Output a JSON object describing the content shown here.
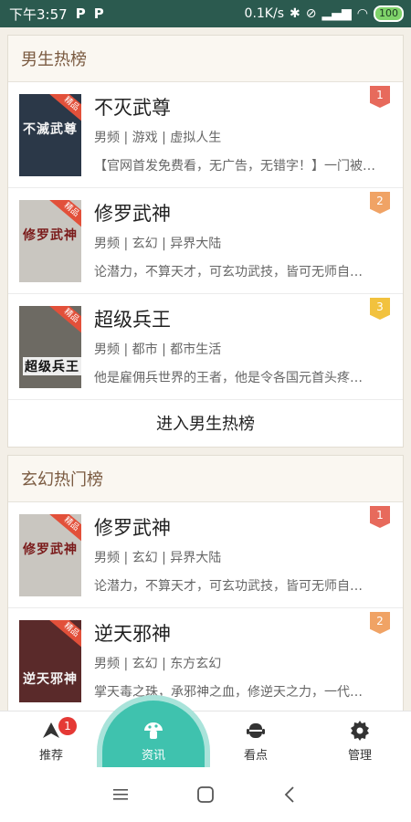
{
  "status": {
    "time": "下午3:57",
    "app_icons": [
      "P",
      "P"
    ],
    "speed": "0.1K/s",
    "battery": "100"
  },
  "sections": [
    {
      "title": "男生热榜",
      "more_label": "进入男生热榜",
      "books": [
        {
          "title": "不灭武尊",
          "tags": "男频  |  游戏  |  虚拟人生",
          "desc": "【官网首发免费看，无广告，无错字！】一门被…",
          "rank": "1",
          "rank_color": "#e76a5c",
          "cover_title": "不滅武尊",
          "cover_bg": "#2b3848",
          "ribbon": "精品"
        },
        {
          "title": "修罗武神",
          "tags": "男频  |  玄幻  |  异界大陆",
          "desc": "论潜力，不算天才，可玄功武技，皆可无师自…",
          "rank": "2",
          "rank_color": "#f0a365",
          "cover_title": "修罗武神",
          "cover_bg": "#c9c6c0",
          "ribbon": "精品"
        },
        {
          "title": "超级兵王",
          "tags": "男频  |  都市  |  都市生活",
          "desc": "他是雇佣兵世界的王者，他是令各国元首头疼…",
          "rank": "3",
          "rank_color": "#f2c23e",
          "cover_title": "超级兵王",
          "cover_bg": "#6d6a63",
          "ribbon": "精品"
        }
      ]
    },
    {
      "title": "玄幻热门榜",
      "books": [
        {
          "title": "修罗武神",
          "tags": "男频  |  玄幻  |  异界大陆",
          "desc": "论潜力，不算天才，可玄功武技，皆可无师自…",
          "rank": "1",
          "rank_color": "#e76a5c",
          "cover_title": "修罗武神",
          "cover_bg": "#c9c6c0",
          "ribbon": "精品"
        },
        {
          "title": "逆天邪神",
          "tags": "男频  |  玄幻  |  东方玄幻",
          "desc": "掌天毒之珠，承邪神之血，修逆天之力，一代…",
          "rank": "2",
          "rank_color": "#f0a365",
          "cover_title": "逆天邪神",
          "cover_bg": "#5a2a2a",
          "ribbon": "精品"
        }
      ]
    }
  ],
  "tabs": [
    {
      "label": "推荐",
      "icon": "recommend-icon",
      "badge": "1"
    },
    {
      "label": "资讯",
      "icon": "mushroom-icon",
      "active": true
    },
    {
      "label": "看点",
      "icon": "robot-icon"
    },
    {
      "label": "管理",
      "icon": "gear-icon"
    }
  ]
}
